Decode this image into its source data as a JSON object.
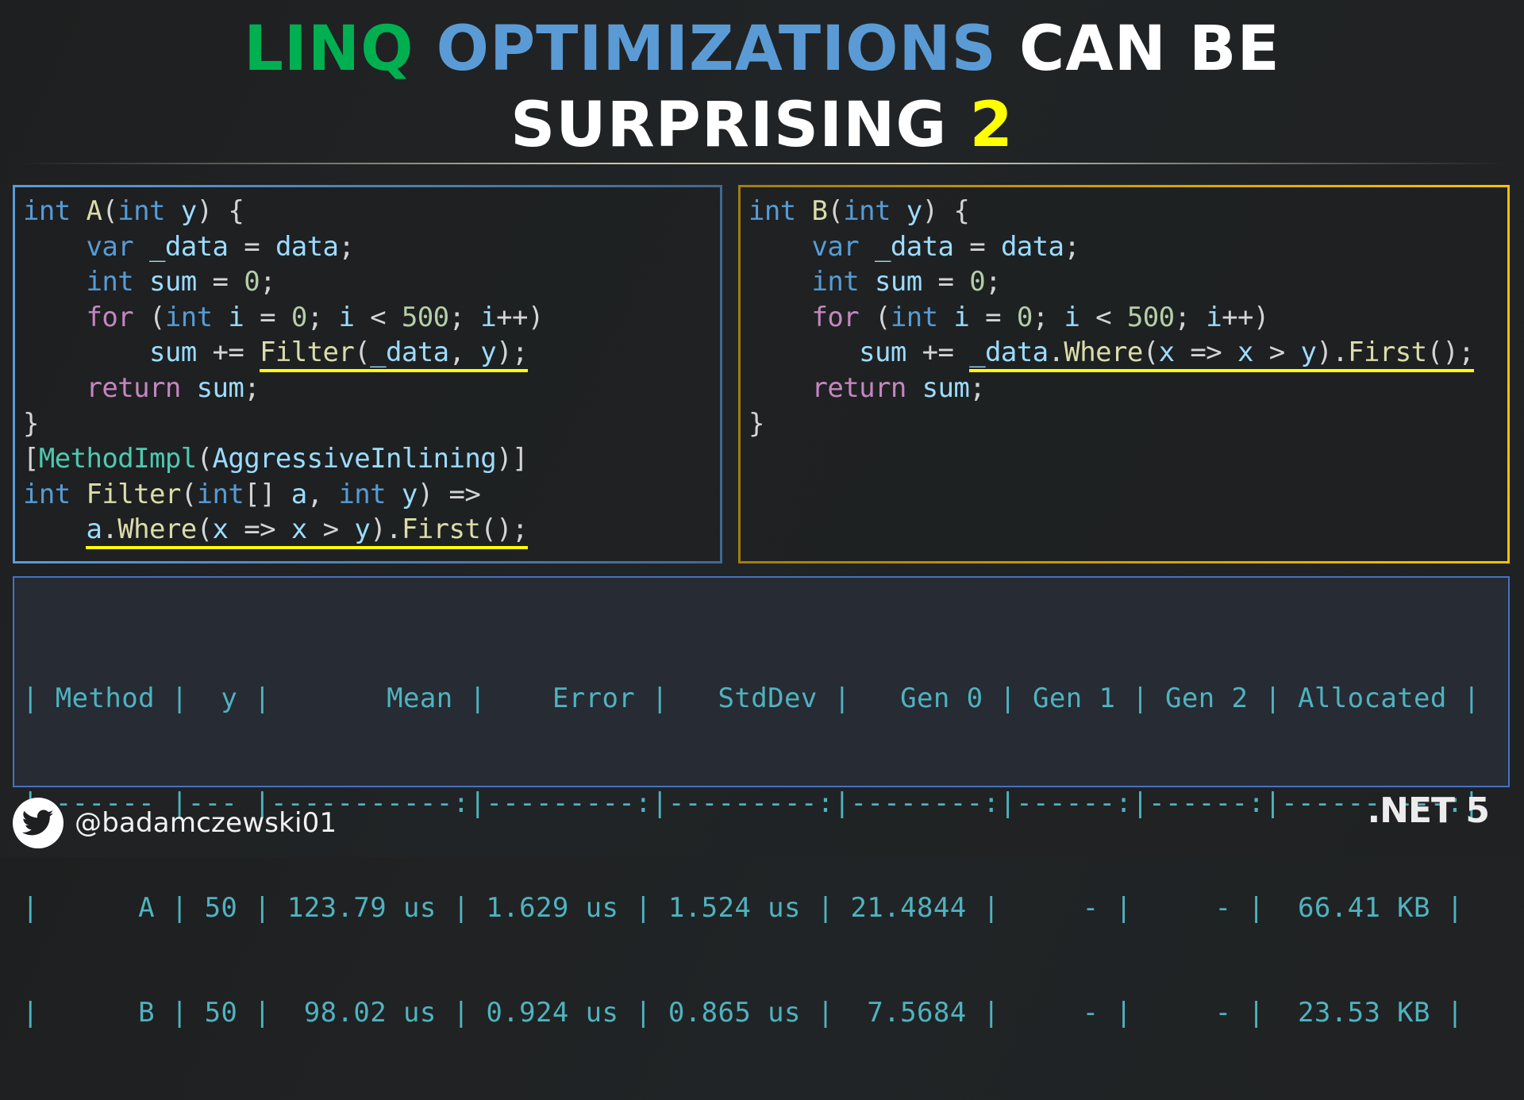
{
  "title": {
    "line1": [
      {
        "text": "LINQ",
        "style": "linq"
      },
      {
        "text": " "
      },
      {
        "text": "OPTIMIZATIONS",
        "style": "opt"
      },
      {
        "text": " CAN BE"
      }
    ],
    "line2_text": "SURPRISING ",
    "line2_number": "2",
    "colors": {
      "linq": "#00b050",
      "optimizations": "#5b9bd5",
      "number": "#ffff00",
      "default": "#ffffff"
    }
  },
  "panel_a": {
    "border_color": "#5b9bd5",
    "lines": [
      [
        [
          "kw",
          "int"
        ],
        [
          "pun",
          " "
        ],
        [
          "fn",
          "A"
        ],
        [
          "pun",
          "("
        ],
        [
          "kw",
          "int"
        ],
        [
          "pun",
          " "
        ],
        [
          "id",
          "y"
        ],
        [
          "pun",
          ") {"
        ]
      ],
      [
        [
          "pun",
          "    "
        ],
        [
          "kw",
          "var"
        ],
        [
          "pun",
          " "
        ],
        [
          "id",
          "_data"
        ],
        [
          "pun",
          " = "
        ],
        [
          "id",
          "data"
        ],
        [
          "pun",
          ";"
        ]
      ],
      [
        [
          "pun",
          "    "
        ],
        [
          "kw",
          "int"
        ],
        [
          "pun",
          " "
        ],
        [
          "id",
          "sum"
        ],
        [
          "pun",
          " = "
        ],
        [
          "num-lit",
          "0"
        ],
        [
          "pun",
          ";"
        ]
      ],
      [
        [
          "pun",
          "    "
        ],
        [
          "ctl",
          "for"
        ],
        [
          "pun",
          " ("
        ],
        [
          "kw",
          "int"
        ],
        [
          "pun",
          " "
        ],
        [
          "id",
          "i"
        ],
        [
          "pun",
          " = "
        ],
        [
          "num-lit",
          "0"
        ],
        [
          "pun",
          "; "
        ],
        [
          "id",
          "i"
        ],
        [
          "pun",
          " < "
        ],
        [
          "num-lit",
          "500"
        ],
        [
          "pun",
          "; "
        ],
        [
          "id",
          "i"
        ],
        [
          "pun",
          "++)"
        ]
      ],
      [
        [
          "pun",
          "        "
        ],
        [
          "id",
          "sum"
        ],
        [
          "pun",
          " += "
        ],
        [
          "hl-start",
          ""
        ],
        [
          "fn",
          "Filter"
        ],
        [
          "pun",
          "("
        ],
        [
          "id",
          "_data"
        ],
        [
          "pun",
          ", "
        ],
        [
          "id",
          "y"
        ],
        [
          "pun",
          ");"
        ],
        [
          "hl-end",
          ""
        ]
      ],
      [
        [
          "pun",
          "    "
        ],
        [
          "ctl",
          "return"
        ],
        [
          "pun",
          " "
        ],
        [
          "id",
          "sum"
        ],
        [
          "pun",
          ";"
        ]
      ],
      [
        [
          "pun",
          "}"
        ]
      ],
      [
        [
          "pun",
          "["
        ],
        [
          "typ",
          "MethodImpl"
        ],
        [
          "pun",
          "("
        ],
        [
          "id",
          "AggressiveInlining"
        ],
        [
          "pun",
          ")]"
        ]
      ],
      [
        [
          "kw",
          "int"
        ],
        [
          "pun",
          " "
        ],
        [
          "fn",
          "Filter"
        ],
        [
          "pun",
          "("
        ],
        [
          "kw",
          "int"
        ],
        [
          "pun",
          "[] "
        ],
        [
          "id",
          "a"
        ],
        [
          "pun",
          ", "
        ],
        [
          "kw",
          "int"
        ],
        [
          "pun",
          " "
        ],
        [
          "id",
          "y"
        ],
        [
          "pun",
          ") =>"
        ]
      ],
      [
        [
          "pun",
          "    "
        ],
        [
          "hl-start",
          ""
        ],
        [
          "id",
          "a"
        ],
        [
          "pun",
          "."
        ],
        [
          "fn",
          "Where"
        ],
        [
          "pun",
          "("
        ],
        [
          "id",
          "x"
        ],
        [
          "pun",
          " => "
        ],
        [
          "id",
          "x"
        ],
        [
          "pun",
          " > "
        ],
        [
          "id",
          "y"
        ],
        [
          "pun",
          ")."
        ],
        [
          "fn",
          "First"
        ],
        [
          "pun",
          "();"
        ],
        [
          "hl-end",
          ""
        ]
      ]
    ]
  },
  "panel_b": {
    "border_color": "#ffc000",
    "lines": [
      [
        [
          "kw",
          "int"
        ],
        [
          "pun",
          " "
        ],
        [
          "fn",
          "B"
        ],
        [
          "pun",
          "("
        ],
        [
          "kw",
          "int"
        ],
        [
          "pun",
          " "
        ],
        [
          "id",
          "y"
        ],
        [
          "pun",
          ") {"
        ]
      ],
      [
        [
          "pun",
          "    "
        ],
        [
          "kw",
          "var"
        ],
        [
          "pun",
          " "
        ],
        [
          "id",
          "_data"
        ],
        [
          "pun",
          " = "
        ],
        [
          "id",
          "data"
        ],
        [
          "pun",
          ";"
        ]
      ],
      [
        [
          "pun",
          "    "
        ],
        [
          "kw",
          "int"
        ],
        [
          "pun",
          " "
        ],
        [
          "id",
          "sum"
        ],
        [
          "pun",
          " = "
        ],
        [
          "num-lit",
          "0"
        ],
        [
          "pun",
          ";"
        ]
      ],
      [
        [
          "pun",
          "    "
        ],
        [
          "ctl",
          "for"
        ],
        [
          "pun",
          " ("
        ],
        [
          "kw",
          "int"
        ],
        [
          "pun",
          " "
        ],
        [
          "id",
          "i"
        ],
        [
          "pun",
          " = "
        ],
        [
          "num-lit",
          "0"
        ],
        [
          "pun",
          "; "
        ],
        [
          "id",
          "i"
        ],
        [
          "pun",
          " < "
        ],
        [
          "num-lit",
          "500"
        ],
        [
          "pun",
          "; "
        ],
        [
          "id",
          "i"
        ],
        [
          "pun",
          "++)"
        ]
      ],
      [
        [
          "pun",
          "       "
        ],
        [
          "id",
          "sum"
        ],
        [
          "pun",
          " += "
        ],
        [
          "hl-start",
          ""
        ],
        [
          "id",
          "_data"
        ],
        [
          "pun",
          "."
        ],
        [
          "fn",
          "Where"
        ],
        [
          "pun",
          "("
        ],
        [
          "id",
          "x"
        ],
        [
          "pun",
          " => "
        ],
        [
          "id",
          "x"
        ],
        [
          "pun",
          " > "
        ],
        [
          "id",
          "y"
        ],
        [
          "pun",
          ")."
        ],
        [
          "fn",
          "First"
        ],
        [
          "pun",
          "();"
        ],
        [
          "hl-end",
          ""
        ]
      ],
      [
        [
          "pun",
          "    "
        ],
        [
          "ctl",
          "return"
        ],
        [
          "pun",
          " "
        ],
        [
          "id",
          "sum"
        ],
        [
          "pun",
          ";"
        ]
      ],
      [
        [
          "pun",
          "}"
        ]
      ]
    ]
  },
  "benchmark": {
    "columns": [
      "Method",
      "y",
      "Mean",
      "Error",
      "StdDev",
      "Gen 0",
      "Gen 1",
      "Gen 2",
      "Allocated"
    ],
    "rows": [
      {
        "Method": "A",
        "y": "50",
        "Mean": "123.79 us",
        "Error": "1.629 us",
        "StdDev": "1.524 us",
        "Gen 0": "21.4844",
        "Gen 1": "-",
        "Gen 2": "-",
        "Allocated": "66.41 KB"
      },
      {
        "Method": "B",
        "y": "50",
        "Mean": "98.02 us",
        "Error": "0.924 us",
        "StdDev": "0.865 us",
        "Gen 0": "7.5684",
        "Gen 1": "-",
        "Gen 2": "-",
        "Allocated": "23.53 KB"
      }
    ],
    "lines": [
      "| Method |  y |       Mean |    Error |   StdDev |   Gen 0 | Gen 1 | Gen 2 | Allocated |",
      "|------- |--- |-----------:|---------:|---------:|--------:|------:|------:|----------:|",
      "|      A | 50 | 123.79 us | 1.629 us | 1.524 us | 21.4844 |     - |     - |  66.41 KB |",
      "|      B | 50 |  98.02 us | 0.924 us | 0.865 us |  7.5684 |     - |     - |  23.53 KB |"
    ],
    "text_color": "#4fb3bf"
  },
  "footer": {
    "icon": "twitter-bird-icon",
    "handle": "@badamczewski01",
    "badge": ".NET 5"
  }
}
